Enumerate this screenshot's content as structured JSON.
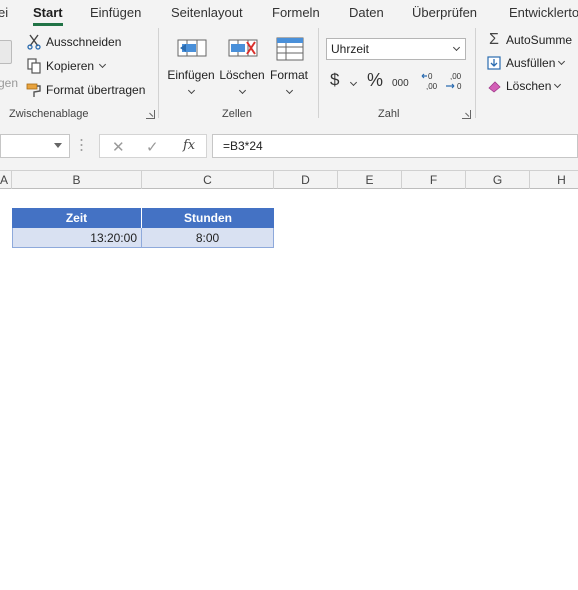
{
  "tabs": [
    "ei",
    "Start",
    "Einfügen",
    "Seitenlayout",
    "Formeln",
    "Daten",
    "Überprüfen",
    "Entwicklertools"
  ],
  "clipboard": {
    "paste_label": "gen",
    "cut_label": "Ausschneiden",
    "copy_label": "Kopieren",
    "format_painter_label": "Format übertragen",
    "group_label": "Zwischenablage"
  },
  "cells_group": {
    "insert_label": "Einfügen",
    "delete_label": "Löschen",
    "format_label": "Format",
    "group_label": "Zellen"
  },
  "number_group": {
    "format_value": "Uhrzeit",
    "currency_symbol": "$",
    "percent_symbol": "%",
    "thousands_label": "000",
    "group_label": "Zahl"
  },
  "editing_group": {
    "autosum_label": "AutoSumme",
    "fill_label": "Ausfüllen",
    "clear_label": "Löschen"
  },
  "formula_bar": {
    "cancel_symbol": "✕",
    "enter_symbol": "✓",
    "fx_label": "fx",
    "formula": "=B3*24"
  },
  "columns": [
    "A",
    "B",
    "C",
    "D",
    "E",
    "F",
    "G",
    "H"
  ],
  "table": {
    "headers": [
      "Zeit",
      "Stunden"
    ],
    "rows": [
      [
        "13:20:00",
        "8:00"
      ]
    ]
  },
  "colors": {
    "accent": "#217346",
    "table_header": "#4472c4",
    "table_row": "#d9e1f2"
  }
}
